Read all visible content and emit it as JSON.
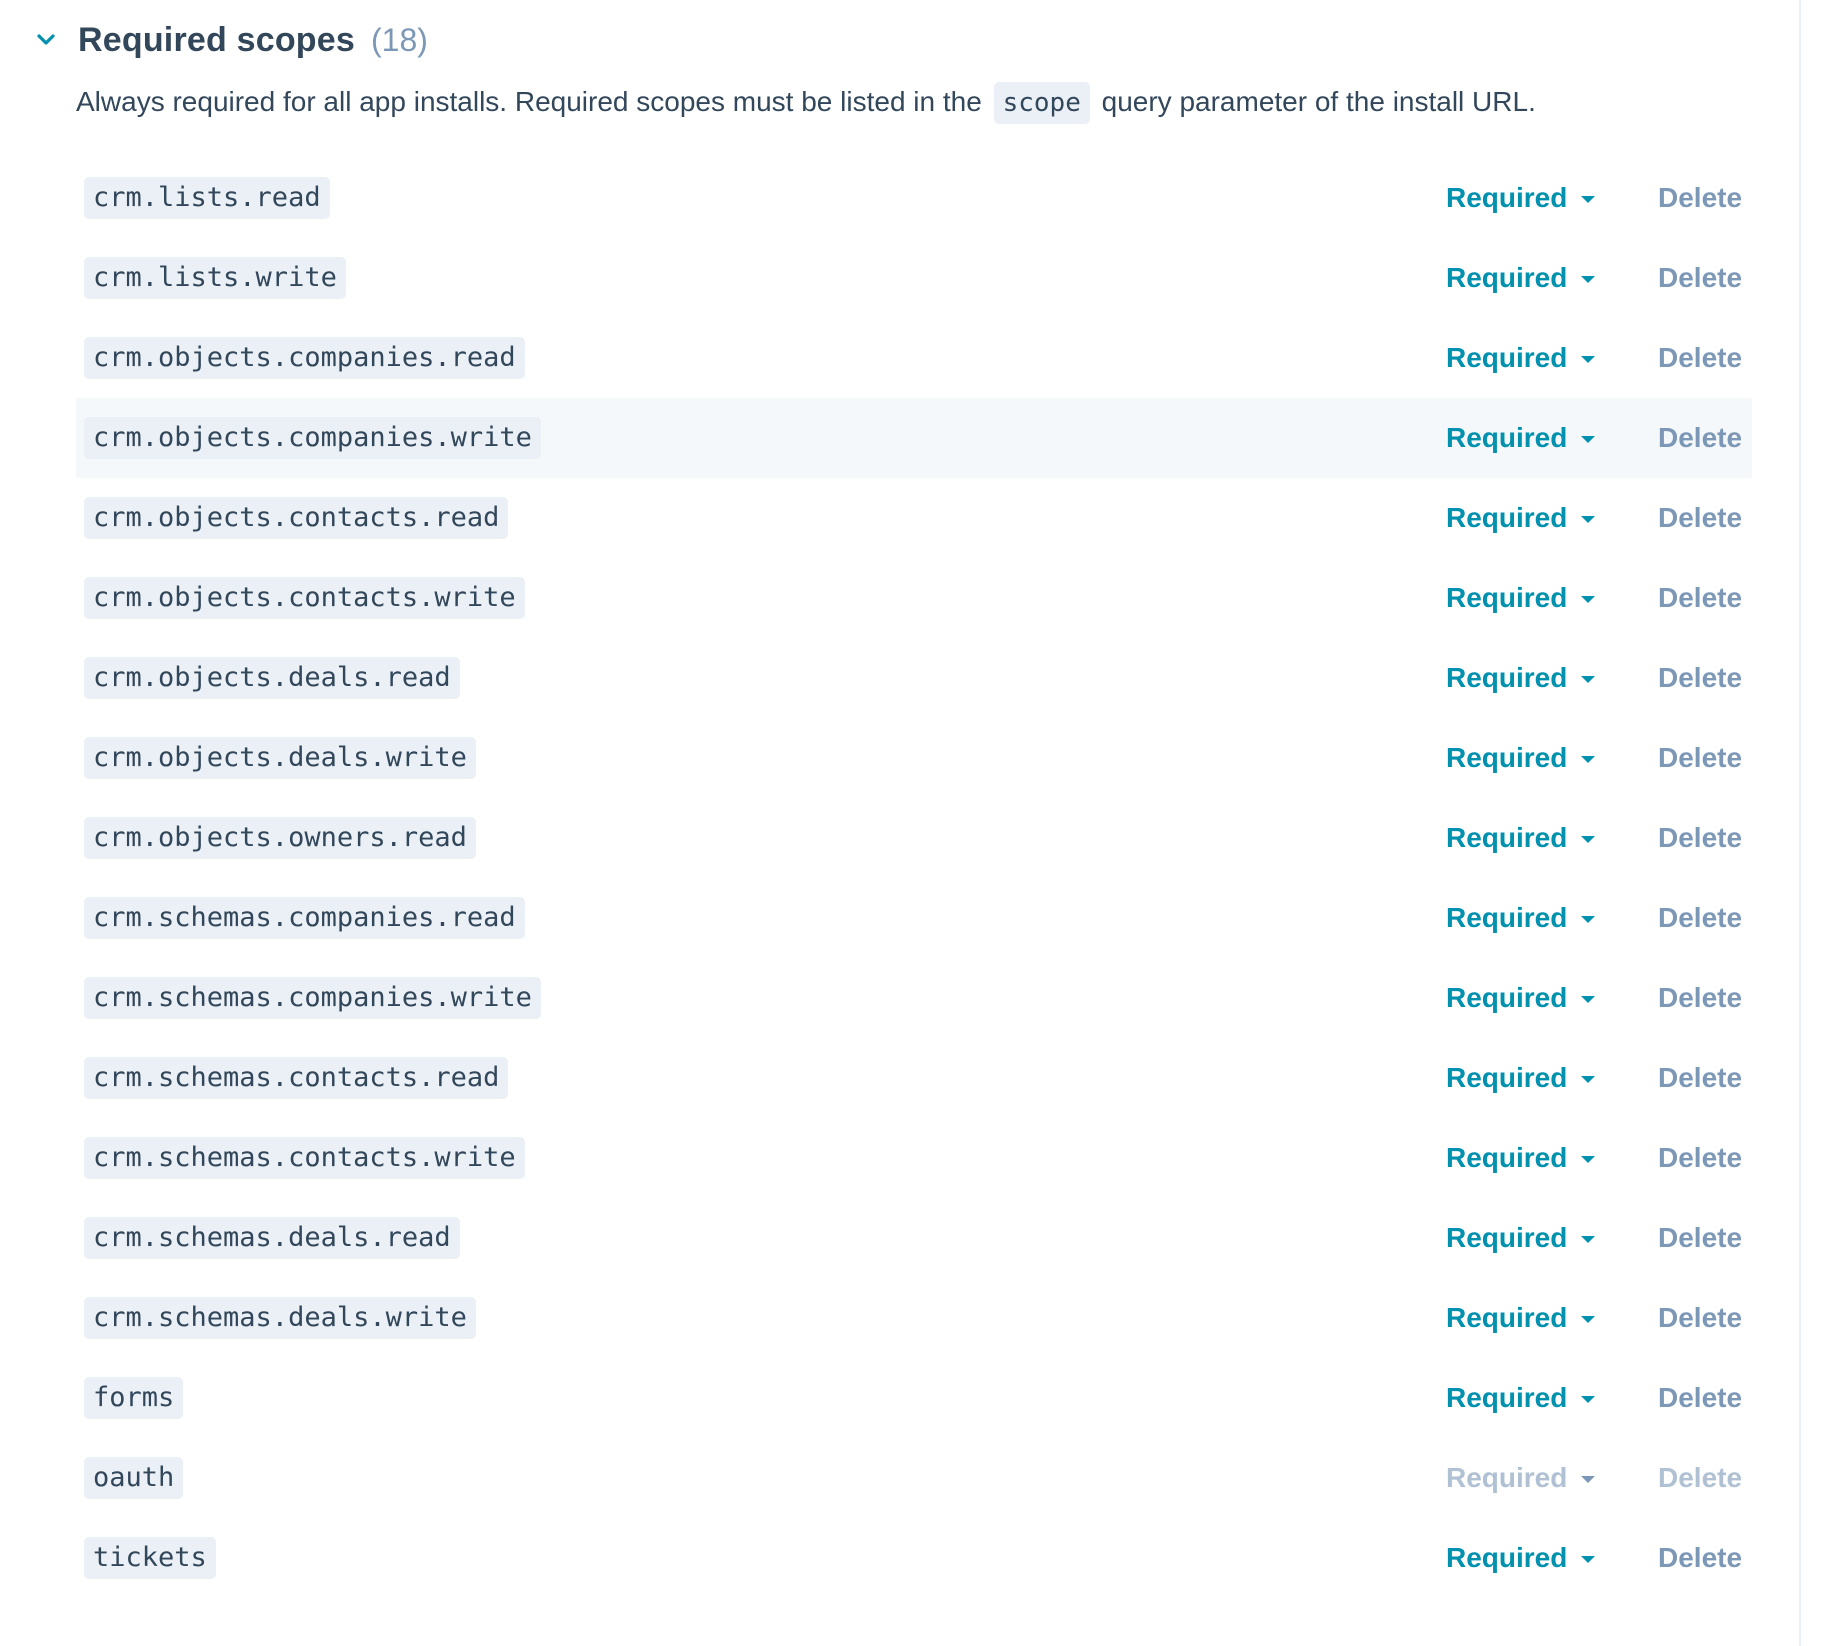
{
  "section": {
    "title": "Required scopes",
    "count": "(18)",
    "description_before": "Always required for all app installs. Required scopes must be listed in the",
    "description_code": "scope",
    "description_after": "query parameter of the install URL."
  },
  "action_labels": {
    "required": "Required",
    "delete": "Delete"
  },
  "scopes": [
    {
      "name": "crm.lists.read",
      "status": "Required",
      "action": "Delete",
      "disabled": false
    },
    {
      "name": "crm.lists.write",
      "status": "Required",
      "action": "Delete",
      "disabled": false
    },
    {
      "name": "crm.objects.companies.read",
      "status": "Required",
      "action": "Delete",
      "disabled": false
    },
    {
      "name": "crm.objects.companies.write",
      "status": "Required",
      "action": "Delete",
      "disabled": false,
      "hovered": true
    },
    {
      "name": "crm.objects.contacts.read",
      "status": "Required",
      "action": "Delete",
      "disabled": false
    },
    {
      "name": "crm.objects.contacts.write",
      "status": "Required",
      "action": "Delete",
      "disabled": false
    },
    {
      "name": "crm.objects.deals.read",
      "status": "Required",
      "action": "Delete",
      "disabled": false
    },
    {
      "name": "crm.objects.deals.write",
      "status": "Required",
      "action": "Delete",
      "disabled": false
    },
    {
      "name": "crm.objects.owners.read",
      "status": "Required",
      "action": "Delete",
      "disabled": false
    },
    {
      "name": "crm.schemas.companies.read",
      "status": "Required",
      "action": "Delete",
      "disabled": false
    },
    {
      "name": "crm.schemas.companies.write",
      "status": "Required",
      "action": "Delete",
      "disabled": false
    },
    {
      "name": "crm.schemas.contacts.read",
      "status": "Required",
      "action": "Delete",
      "disabled": false
    },
    {
      "name": "crm.schemas.contacts.write",
      "status": "Required",
      "action": "Delete",
      "disabled": false
    },
    {
      "name": "crm.schemas.deals.read",
      "status": "Required",
      "action": "Delete",
      "disabled": false
    },
    {
      "name": "crm.schemas.deals.write",
      "status": "Required",
      "action": "Delete",
      "disabled": false
    },
    {
      "name": "forms",
      "status": "Required",
      "action": "Delete",
      "disabled": false
    },
    {
      "name": "oauth",
      "status": "Required",
      "action": "Delete",
      "disabled": true
    },
    {
      "name": "tickets",
      "status": "Required",
      "action": "Delete",
      "disabled": false
    }
  ],
  "colors": {
    "accent": "#0091ae",
    "text": "#33475b",
    "muted": "#7c98b6",
    "disabled": "#b0c1d4",
    "code_bg": "#eaf0f6",
    "hover_bg": "#f5f8fa"
  },
  "icons": {
    "collapse": "chevron-down-icon",
    "dropdown": "caret-down-icon"
  }
}
